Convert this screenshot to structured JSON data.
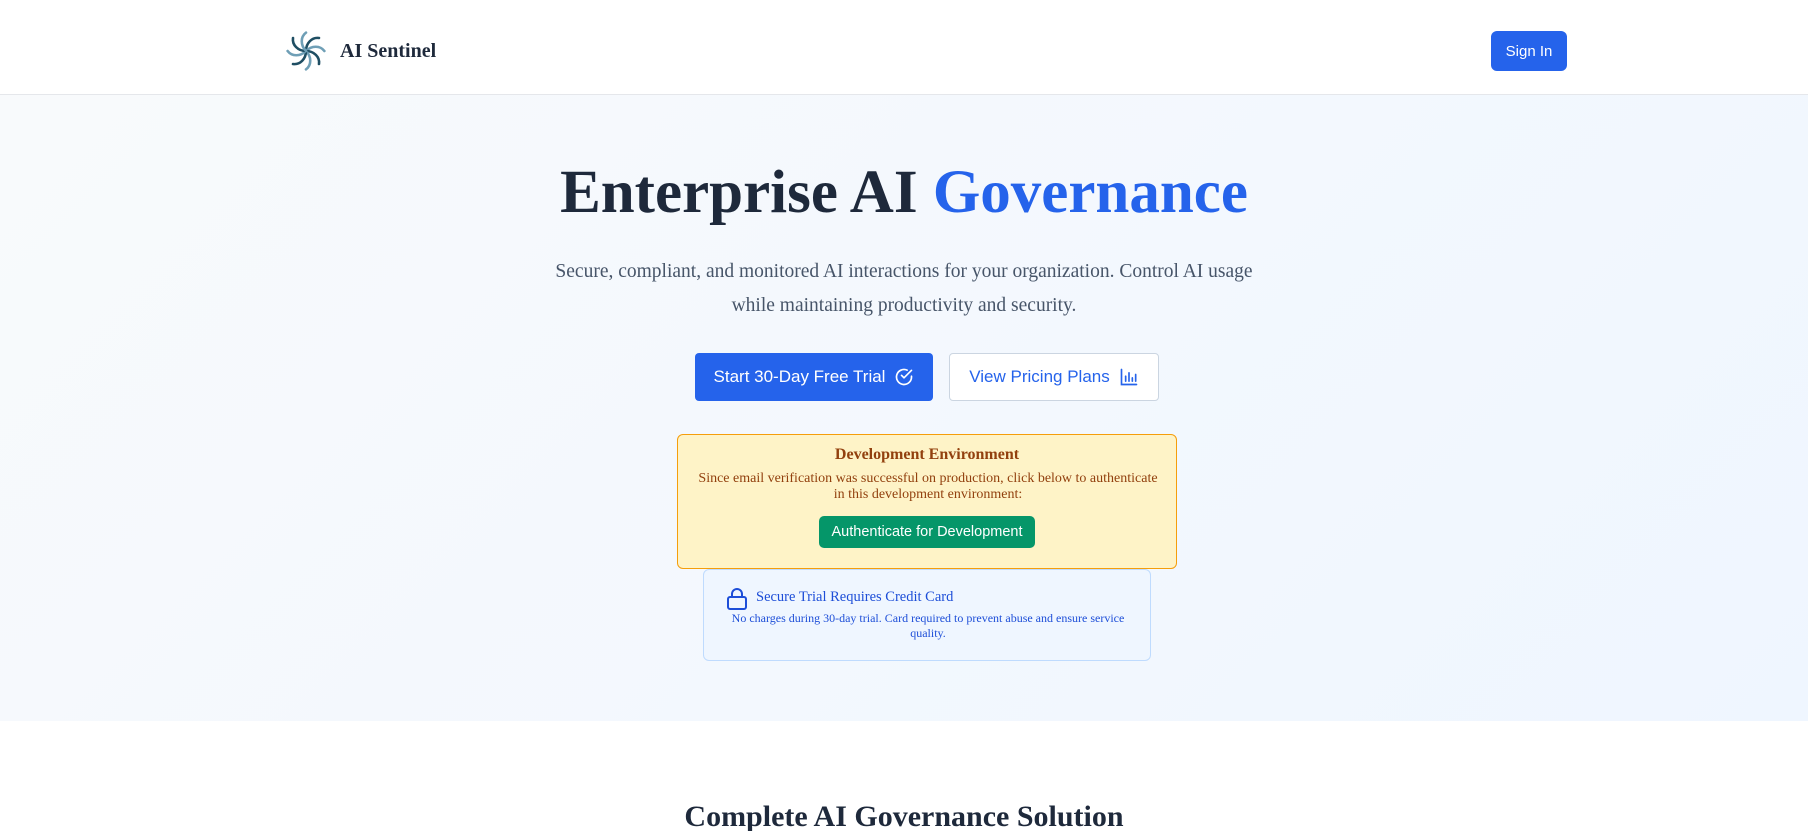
{
  "header": {
    "brand_name": "AI Sentinel",
    "logo_icon": "spiral-flower-logo-icon",
    "signin_label": "Sign In"
  },
  "hero": {
    "title_main": "Enterprise AI ",
    "title_accent": "Governance",
    "subtitle": "Secure, compliant, and monitored AI interactions for your organization. Control AI usage while maintaining productivity and security.",
    "primary_button": {
      "label": "Start 30-Day Free Trial",
      "icon": "check-circle-icon"
    },
    "secondary_button": {
      "label": "View Pricing Plans",
      "icon": "bar-chart-icon"
    }
  },
  "dev_notice": {
    "title": "Development Environment",
    "text": "Since email verification was successful on production, click below to authenticate in this development environment:",
    "button_label": "Authenticate for Development"
  },
  "trial_notice": {
    "icon": "lock-icon",
    "title": "Secure Trial Requires Credit Card",
    "text": "No charges during 30-day trial. Card required to prevent abuse and ensure service quality."
  },
  "features": {
    "heading": "Complete AI Governance Solution"
  },
  "colors": {
    "brand_blue": "#2563eb",
    "dev_bg": "#fef3c7",
    "dev_border": "#f59e0b",
    "dev_button": "#059669",
    "notice_bg": "#eff6ff"
  }
}
